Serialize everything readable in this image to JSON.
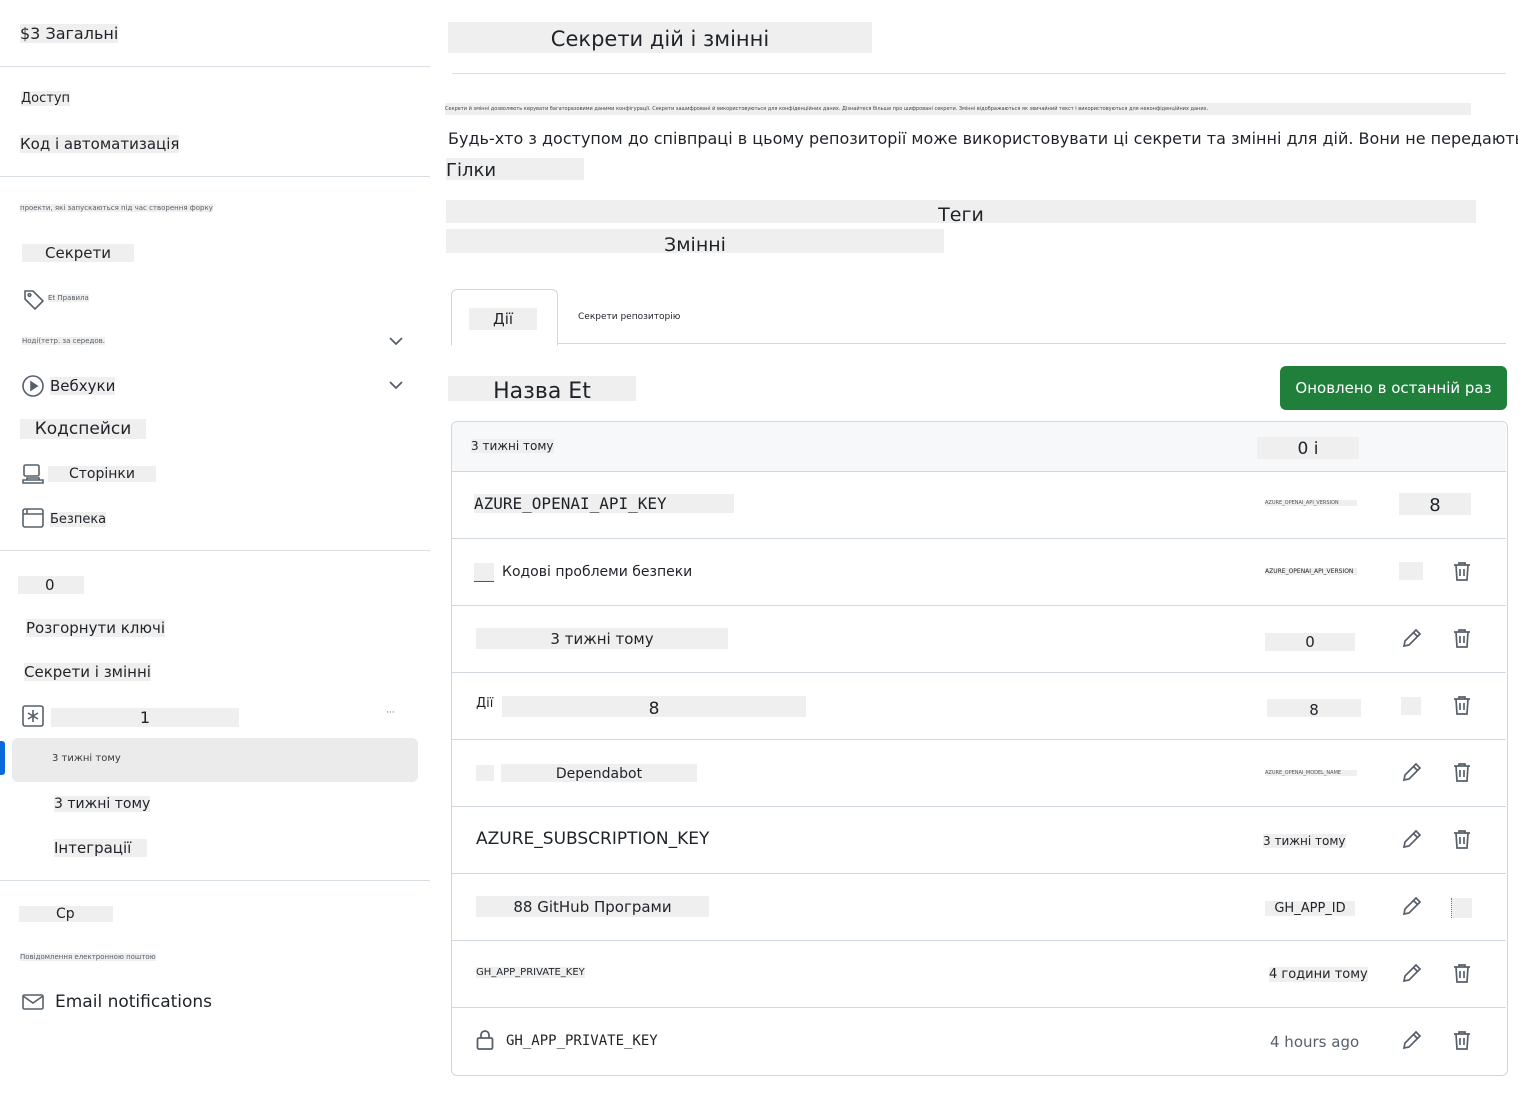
{
  "sidebar": {
    "general": "$3 Загальні",
    "access_heading": "Доступ",
    "code_automation": "Код і автоматизація",
    "fork_note": "проекти, які запускаються під час створення форку",
    "secrets": "Секрети",
    "rules_label": "Et Правила",
    "environments_label": "Ноді(тетр. за середов.",
    "webhooks": "Вебхуки",
    "codespaces": "Кодспейси",
    "pages": "Сторінки",
    "security": "Безпека",
    "zero": "0",
    "deploy_keys": "Розгорнути ключі",
    "secrets_vars": "Секрети і змінні",
    "one": "1",
    "ellipsis": "···",
    "active_item": "3 тижні тому",
    "three_weeks": "3 тижні тому",
    "integrations": "Інтеграції",
    "wed": "Ср",
    "email_section": "Повідомлення електронною поштою",
    "email_notifications": "Email notifications"
  },
  "main": {
    "title": "Секрети дій і змінні",
    "desc_small": "Секрети й змінні дозволяють керувати багаторазовими даними конфігурації. Секрети зашифровані й використовуються для конфіденційних даних. Дізнайтеся більше про шифровані секрети. Змінні відображаються як звичайний текст і використовуються для неконфіденційних даних.",
    "description": "Будь-хто з доступом до співпраці в цьому репозиторії може використовувати ці секрети та змінні для дій. Вони не передаються до",
    "branches": "Гілки",
    "tags": "Теги",
    "variables": "Змінні",
    "tabs": [
      {
        "label": "Дії"
      },
      {
        "label": "Секрети репозиторію"
      }
    ],
    "section_title": "Назва Et",
    "new_button": "Оновлено в останній раз",
    "table_header": {
      "name": "3 тижні тому",
      "updated": "0 і"
    },
    "rows": [
      {
        "name": "AZURE_OPENAI_API_KEY",
        "updated": "AZURE_OPENAI_API_VERSION",
        "edit": "8"
      },
      {
        "name": "Кодові проблеми безпеки",
        "updated": "AZURE_OPENAI_API_VERSION",
        "edit": ""
      },
      {
        "name": "3 тижні тому",
        "updated": "0",
        "edit": ""
      },
      {
        "name_prefix": "Дії",
        "name": "8",
        "updated": "8",
        "edit": ""
      },
      {
        "name": "Dependabot",
        "updated": "AZURE_OPENAI_MODEL_NAME",
        "edit": ""
      },
      {
        "name": "AZURE_SUBSCRIPTION_KEY",
        "updated": "3 тижні тому",
        "edit": ""
      },
      {
        "name": "88 GitHub Програми",
        "updated": "GH_APP_ID",
        "edit": ""
      },
      {
        "name": "GH_APP_PRIVATE_KEY",
        "updated": "4 години тому",
        "edit": ""
      },
      {
        "name": "GH_APP_PRIVATE_KEY",
        "updated": "4 hours ago",
        "edit": ""
      }
    ]
  },
  "colors": {
    "accent": "#0969da",
    "button_green": "#1f7f3b",
    "highlight": "#efefef",
    "border": "#d0d7de"
  }
}
